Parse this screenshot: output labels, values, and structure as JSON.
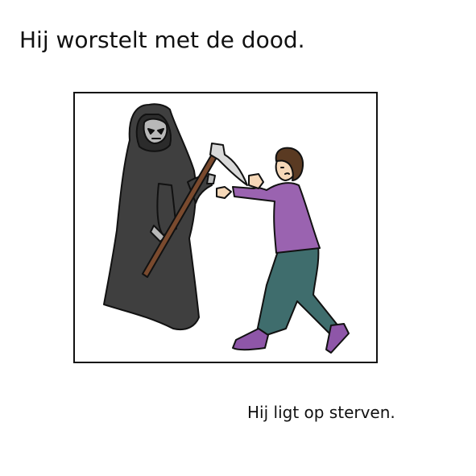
{
  "title": "Hij worstelt met de dood.",
  "caption": "Hij ligt op sterven.",
  "colors": {
    "robe": "#3f3f3f",
    "skull": "#b8b8b8",
    "scythe_handle": "#7a4a2e",
    "blade": "#d9d9d9",
    "shirt": "#9a63b0",
    "pants": "#3f6d6d",
    "shoes": "#8e56a8",
    "skin": "#f6d8b8",
    "hair": "#5a3a22"
  }
}
